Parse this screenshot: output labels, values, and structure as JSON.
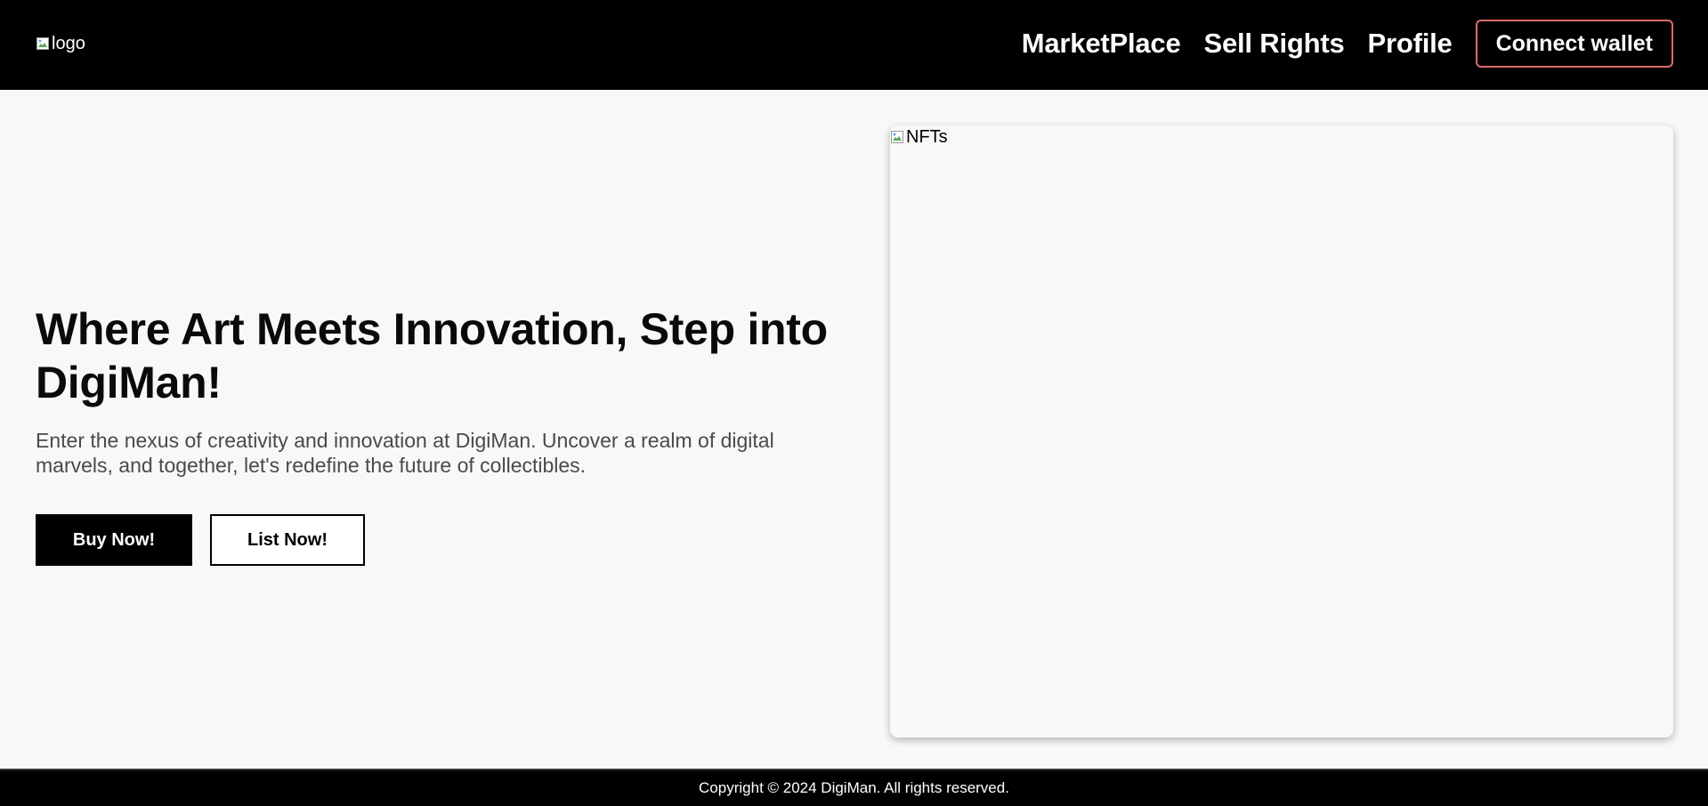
{
  "header": {
    "logo_alt": "logo",
    "nav": [
      {
        "label": "MarketPlace"
      },
      {
        "label": "Sell Rights"
      },
      {
        "label": "Profile"
      }
    ],
    "connect_label": "Connect wallet"
  },
  "hero": {
    "title": "Where Art Meets Innovation, Step into DigiMan!",
    "description": "Enter the nexus of creativity and innovation at DigiMan. Uncover a realm of digital marvels, and together, let's redefine the future of collectibles.",
    "buy_label": "Buy Now!",
    "list_label": "List Now!",
    "image_alt": "NFTs"
  },
  "footer": {
    "copyright": "Copyright © 2024 DigiMan. All rights reserved."
  },
  "colors": {
    "nav_bg": "#000000",
    "page_bg": "#f8f8f8",
    "connect_border": "#e06b6b",
    "desc_text": "#4a4a4a"
  },
  "icons": {
    "logo": "broken-image-icon",
    "nft_image": "broken-image-icon"
  }
}
